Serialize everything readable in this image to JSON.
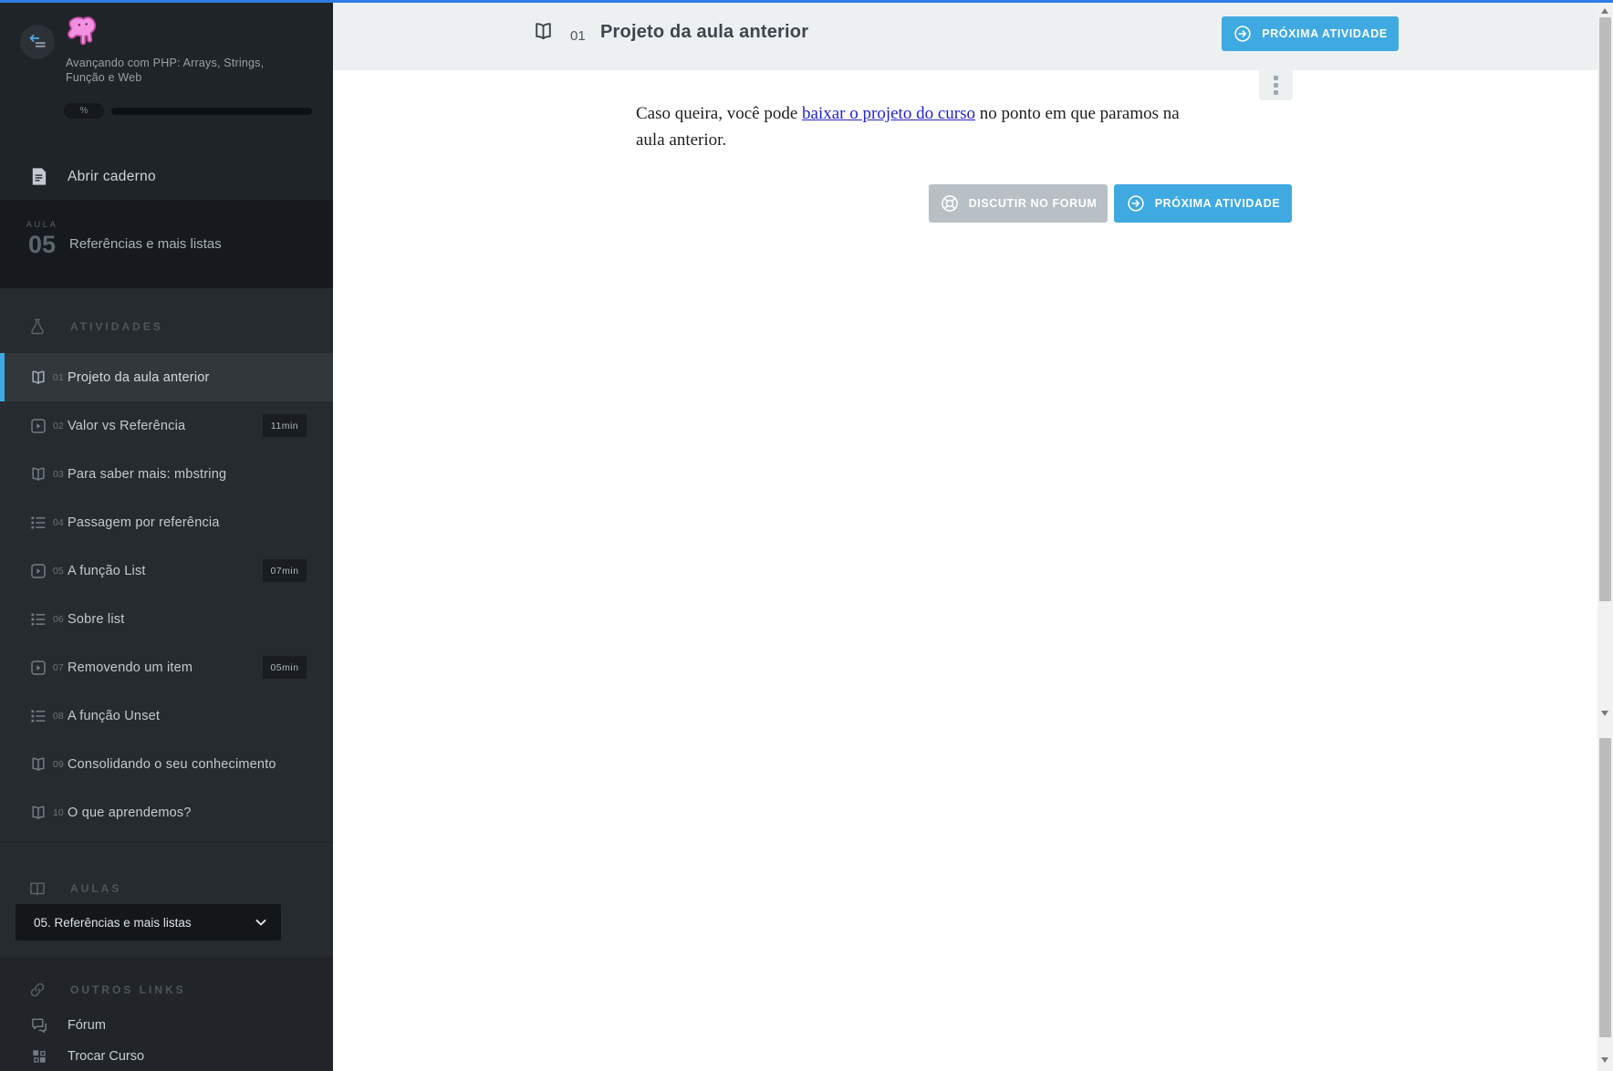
{
  "colors": {
    "accent_blue": "#3fa9e1",
    "topbar_blue": "#2e7ce4",
    "sidebar_bg": "#22262a",
    "link_blue": "#2222cc",
    "header_bg": "#edf0f1"
  },
  "sidebar": {
    "course_title": "Avançando com PHP: Arrays, Strings, Função e Web",
    "progress": {
      "percent_label": "%",
      "percent_fill": 0
    },
    "notebook_label": "Abrir caderno",
    "lesson": {
      "label": "AULA",
      "number": "05",
      "title": "Referências e mais listas"
    },
    "activities_header": "ATIVIDADES",
    "activities": [
      {
        "num": "01",
        "label": "Projeto da aula anterior",
        "type": "reading",
        "duration": "",
        "active": true
      },
      {
        "num": "02",
        "label": "Valor vs Referência",
        "type": "video",
        "duration": "11min",
        "active": false
      },
      {
        "num": "03",
        "label": "Para saber mais: mbstring",
        "type": "reading",
        "duration": "",
        "active": false
      },
      {
        "num": "04",
        "label": "Passagem por referência",
        "type": "exercise",
        "duration": "",
        "active": false
      },
      {
        "num": "05",
        "label": "A função List",
        "type": "video",
        "duration": "07min",
        "active": false
      },
      {
        "num": "06",
        "label": "Sobre list",
        "type": "exercise",
        "duration": "",
        "active": false
      },
      {
        "num": "07",
        "label": "Removendo um item",
        "type": "video",
        "duration": "05min",
        "active": false
      },
      {
        "num": "08",
        "label": "A função Unset",
        "type": "exercise",
        "duration": "",
        "active": false
      },
      {
        "num": "09",
        "label": "Consolidando o seu conhecimento",
        "type": "reading",
        "duration": "",
        "active": false
      },
      {
        "num": "10",
        "label": "O que aprendemos?",
        "type": "reading",
        "duration": "",
        "active": false
      }
    ],
    "aulas_header": "AULAS",
    "lesson_select_value": "05. Referências e mais listas",
    "other_links_header": "OUTROS LINKS",
    "links": [
      {
        "label": "Fórum"
      },
      {
        "label": "Trocar Curso"
      }
    ]
  },
  "header": {
    "activity_number": "01",
    "title": "Projeto da aula anterior",
    "next_button_label": "PRÓXIMA ATIVIDADE"
  },
  "content": {
    "paragraph_before": "Caso queira, você pode ",
    "paragraph_link": "baixar o projeto do curso",
    "paragraph_after": " no ponto em que paramos na aula anterior.",
    "forum_button_label": "DISCUTIR NO FORUM",
    "next_button_label": "PRÓXIMA ATIVIDADE"
  }
}
